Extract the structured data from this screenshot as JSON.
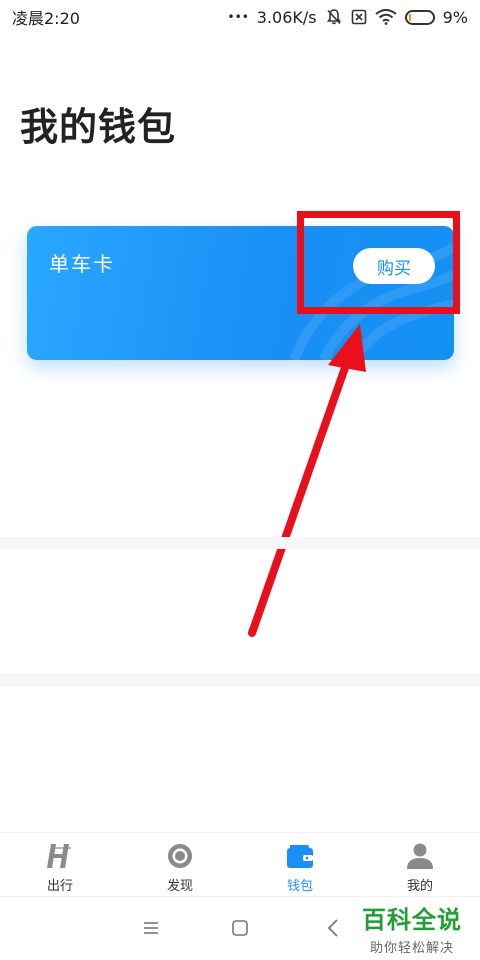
{
  "status_bar": {
    "time": "凌晨2:20",
    "dots": "•••",
    "speed": "3.06K/s",
    "battery": "9%",
    "battery_level": 0.09,
    "icons": [
      "mute-icon",
      "sim-off-icon",
      "wifi-icon",
      "battery-icon"
    ]
  },
  "page": {
    "title": "我的钱包"
  },
  "card": {
    "title": "单车卡",
    "buy_label": "购买"
  },
  "tabs": [
    {
      "label": "出行",
      "icon": "ride-logo-icon",
      "active": false
    },
    {
      "label": "发现",
      "icon": "discover-icon",
      "active": false
    },
    {
      "label": "钱包",
      "icon": "wallet-icon",
      "active": true
    },
    {
      "label": "我的",
      "icon": "person-icon",
      "active": false
    }
  ],
  "watermark": {
    "main": "百科全说",
    "sub": "助你轻松解决"
  },
  "colors": {
    "accent": "#1a8ff5",
    "annotation": "#e8101c",
    "watermark": "#22a035"
  }
}
